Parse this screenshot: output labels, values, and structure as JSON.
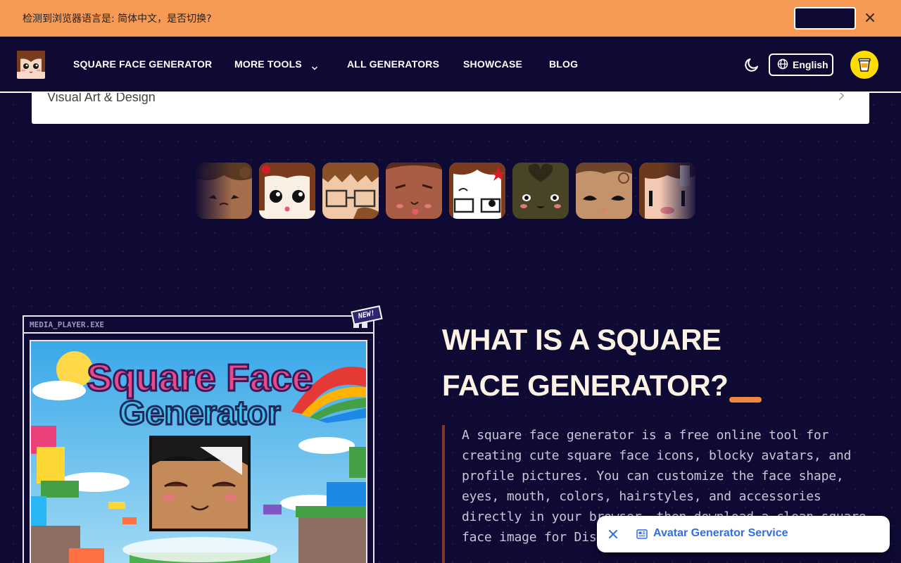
{
  "banner": {
    "message": "检测到浏览器语言是: 简体中文，是否切换?",
    "switch_label": "",
    "close_icon": "close-icon"
  },
  "nav": {
    "logo_icon": "square-face-logo-icon",
    "links": {
      "generator": "SQUARE FACE GENERATOR",
      "more_tools": "MORE TOOLS",
      "all_generators": "ALL GENERATORS",
      "showcase": "SHOWCASE",
      "blog": "BLOG"
    },
    "theme_icon": "moon-icon",
    "language": "English",
    "coffee_icon": "coffee-cup-icon"
  },
  "faq": {
    "item_label": "Visual Art & Design"
  },
  "faces": [
    {
      "name": "curly-hair-face"
    },
    {
      "name": "red-bow-face"
    },
    {
      "name": "glasses-face"
    },
    {
      "name": "tongue-face"
    },
    {
      "name": "red-star-glasses-face"
    },
    {
      "name": "heart-hair-face"
    },
    {
      "name": "curly-tan-face"
    },
    {
      "name": "blush-face"
    }
  ],
  "media": {
    "window_title": "MEDIA_PLAYER.EXE",
    "badge": "NEW!",
    "art_title_line1": "Square Face",
    "art_title_line2": "Generator"
  },
  "about": {
    "heading_line1": "WHAT IS A SQUARE",
    "heading_line2": "FACE GENERATOR?",
    "description": "A square face generator is a free online tool for creating cute square face icons, blocky avatars, and profile pictures. You can customize the face shape, eyes, mouth, colors, hairstyles, and accessories directly in your browser, then download a clean square face image for Discord, and personal use."
  },
  "chip": {
    "label": "Avatar Generator Service",
    "icon": "newspaper-icon",
    "close_icon": "close-icon"
  },
  "colors": {
    "background": "#0e0a33",
    "banner": "#f79a56",
    "accent": "#f0873e",
    "heading": "#fdf3e4",
    "link": "#2f6fe0",
    "coffee": "#ffdd00"
  }
}
